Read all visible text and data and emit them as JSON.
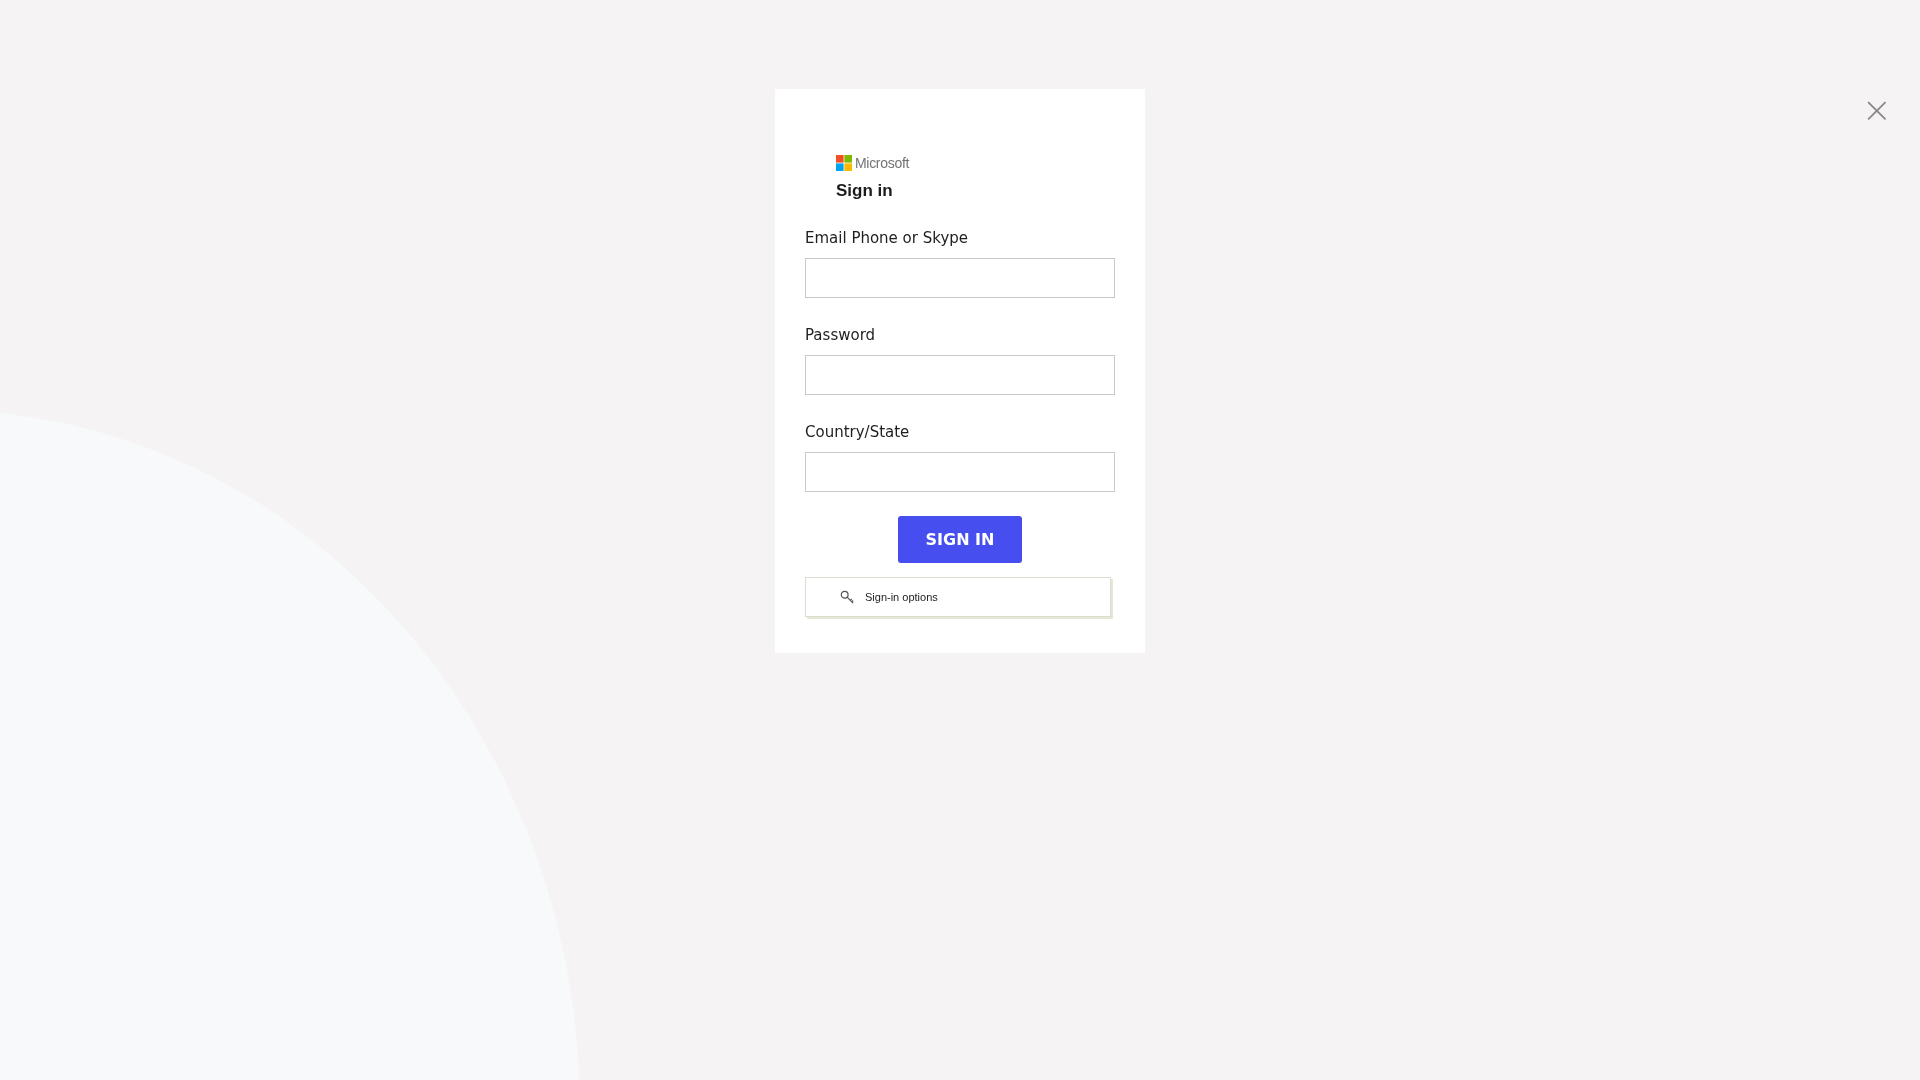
{
  "close_button": {
    "label": "×"
  },
  "dialog": {
    "brand": "Microsoft",
    "title": "Sign in",
    "fields": [
      {
        "label": "Email Phone or Skype"
      },
      {
        "label": "Password"
      },
      {
        "label": "Country/State"
      }
    ],
    "submit_button": "SIGN IN",
    "options_button": "Sign-in options"
  }
}
